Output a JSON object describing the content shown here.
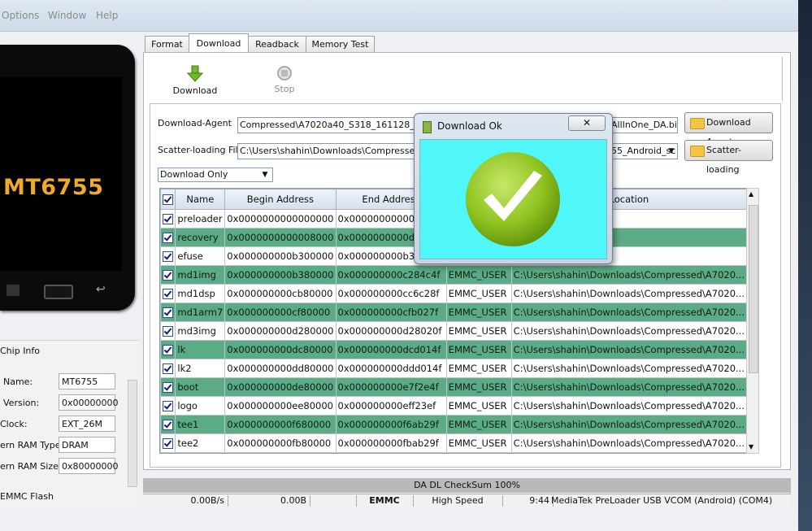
{
  "menu": {
    "items": [
      "Options",
      "Window",
      "Help"
    ]
  },
  "phone": {
    "model_label": "MT6755"
  },
  "chip_info": {
    "title": "Chip Info",
    "rows": [
      {
        "label": "Name:",
        "value": "MT6755"
      },
      {
        "label": "Version:",
        "value": "0x00000000"
      },
      {
        "label": "Clock:",
        "value": "EXT_26M"
      },
      {
        "label": "ern RAM Type:",
        "value": "DRAM"
      },
      {
        "label": "ern RAM Size:",
        "value": "0x80000000"
      }
    ],
    "emmc_label": "EMMC Flash"
  },
  "tabs": [
    "Format",
    "Download",
    "Readback",
    "Memory Test"
  ],
  "active_tab": "Download",
  "toolbar": {
    "download_label": "Download",
    "stop_label": "Stop"
  },
  "fields": {
    "download_agent_label": "Download-Agent",
    "download_agent_value": "Compressed\\A7020a40_S318_161128_ROW",
    "download_agent_tail": "AllInOne_DA.bin",
    "scatter_label": "Scatter-loading File",
    "scatter_value": "C:\\Users\\shahin\\Downloads\\Compressed\\A7",
    "scatter_tail": "55_Android_sc",
    "mode_value": "Download Only"
  },
  "buttons": {
    "download_agent": "Download Agent",
    "scatter_loading": "Scatter-loading"
  },
  "table": {
    "headers": [
      "Name",
      "Begin Address",
      "End Address",
      "",
      "Location"
    ],
    "rows": [
      {
        "name": "preloader",
        "begin": "0x0000000000000000",
        "end": "0x0000000000030d33",
        "region": "",
        "loc": ""
      },
      {
        "name": "recovery",
        "begin": "0x0000000000008000",
        "end": "0x0000000000d2ae4f",
        "region": "",
        "loc": ""
      },
      {
        "name": "efuse",
        "begin": "0x000000000b300000",
        "end": "0x000000000b3001ff",
        "region": "",
        "loc": ""
      },
      {
        "name": "md1img",
        "begin": "0x000000000b380000",
        "end": "0x000000000c284c4f",
        "region": "EMMC_USER",
        "loc": "C:\\Users\\shahin\\Downloads\\Compressed\\A7020..."
      },
      {
        "name": "md1dsp",
        "begin": "0x000000000cb80000",
        "end": "0x000000000cc6c28f",
        "region": "EMMC_USER",
        "loc": "C:\\Users\\shahin\\Downloads\\Compressed\\A7020..."
      },
      {
        "name": "md1arm7",
        "begin": "0x000000000cf80000",
        "end": "0x000000000cfb027f",
        "region": "EMMC_USER",
        "loc": "C:\\Users\\shahin\\Downloads\\Compressed\\A7020..."
      },
      {
        "name": "md3img",
        "begin": "0x000000000d280000",
        "end": "0x000000000d28020f",
        "region": "EMMC_USER",
        "loc": "C:\\Users\\shahin\\Downloads\\Compressed\\A7020..."
      },
      {
        "name": "lk",
        "begin": "0x000000000dc80000",
        "end": "0x000000000dcd014f",
        "region": "EMMC_USER",
        "loc": "C:\\Users\\shahin\\Downloads\\Compressed\\A7020..."
      },
      {
        "name": "lk2",
        "begin": "0x000000000dd80000",
        "end": "0x000000000ddd014f",
        "region": "EMMC_USER",
        "loc": "C:\\Users\\shahin\\Downloads\\Compressed\\A7020..."
      },
      {
        "name": "boot",
        "begin": "0x000000000de80000",
        "end": "0x000000000e7f2e4f",
        "region": "EMMC_USER",
        "loc": "C:\\Users\\shahin\\Downloads\\Compressed\\A7020..."
      },
      {
        "name": "logo",
        "begin": "0x000000000ee80000",
        "end": "0x000000000eff23ef",
        "region": "EMMC_USER",
        "loc": "C:\\Users\\shahin\\Downloads\\Compressed\\A7020..."
      },
      {
        "name": "tee1",
        "begin": "0x000000000f680000",
        "end": "0x000000000f6ab29f",
        "region": "EMMC_USER",
        "loc": "C:\\Users\\shahin\\Downloads\\Compressed\\A7020..."
      },
      {
        "name": "tee2",
        "begin": "0x000000000fb80000",
        "end": "0x000000000fbab29f",
        "region": "EMMC_USER",
        "loc": "C:\\Users\\shahin\\Downloads\\Compressed\\A7020..."
      }
    ],
    "row_colors": {
      "green": "#5aab86",
      "white": "#ffffff"
    }
  },
  "status": {
    "checksum": "DA DL CheckSum 100%",
    "speed": "0.00B/s",
    "bytes": "0.00B",
    "storage": "EMMC",
    "usb_speed": "High Speed",
    "time": "9:44",
    "port": "MediaTek PreLoader USB VCOM (Android) (COM4)"
  },
  "dialog": {
    "title": "Download Ok",
    "close_icon": "close-icon",
    "body_color": "#4ff7f9",
    "check_color": "#8fc31f"
  }
}
